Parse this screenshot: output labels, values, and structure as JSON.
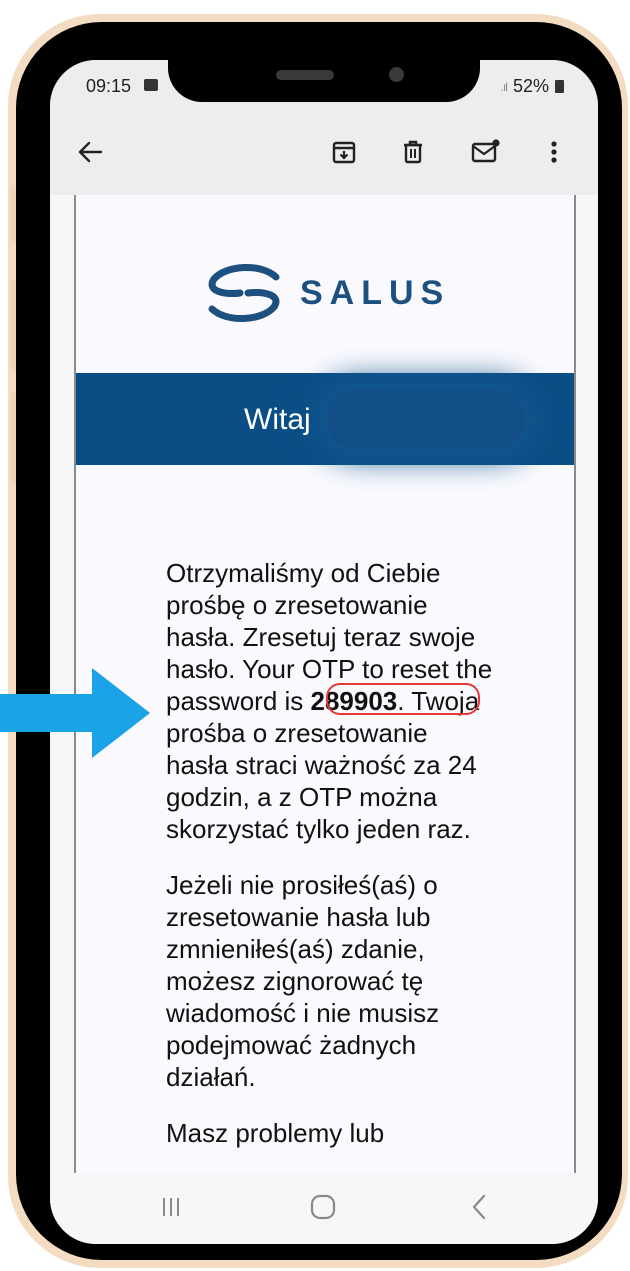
{
  "status_bar": {
    "time": "09:15",
    "battery": "52%"
  },
  "email": {
    "logo_text": "SALUS",
    "banner_title": "Witaj",
    "para1_before": "Otrzymaliśmy od Ciebie prośbę o zresetowanie hasła. Zresetuj teraz swoje hasło. Your OTP to reset the password is ",
    "otp": "289903",
    "para1_after": ". Twoja prośba o zresetowanie hasła straci ważność za 24 godzin, a z OTP można skorzystać tylko jeden raz.",
    "para2": "Jeżeli nie prosiłeś(aś) o zresetowanie hasła lub zmnieniłeś(aś) zdanie, możesz zignorować tę wiadomość i nie musisz podejmować żadnych działań.",
    "para3": "Masz problemy lub"
  },
  "colors": {
    "banner": "#0b4e86",
    "brand": "#1d4f7f",
    "arrow": "#1aa3e6",
    "highlight": "#e53935",
    "frame": "#f3dcc1"
  },
  "icons": [
    "back-arrow-icon",
    "archive-icon",
    "trash-icon",
    "mark-unread-icon",
    "more-vert-icon",
    "recents-icon",
    "home-icon",
    "back-nav-icon"
  ]
}
